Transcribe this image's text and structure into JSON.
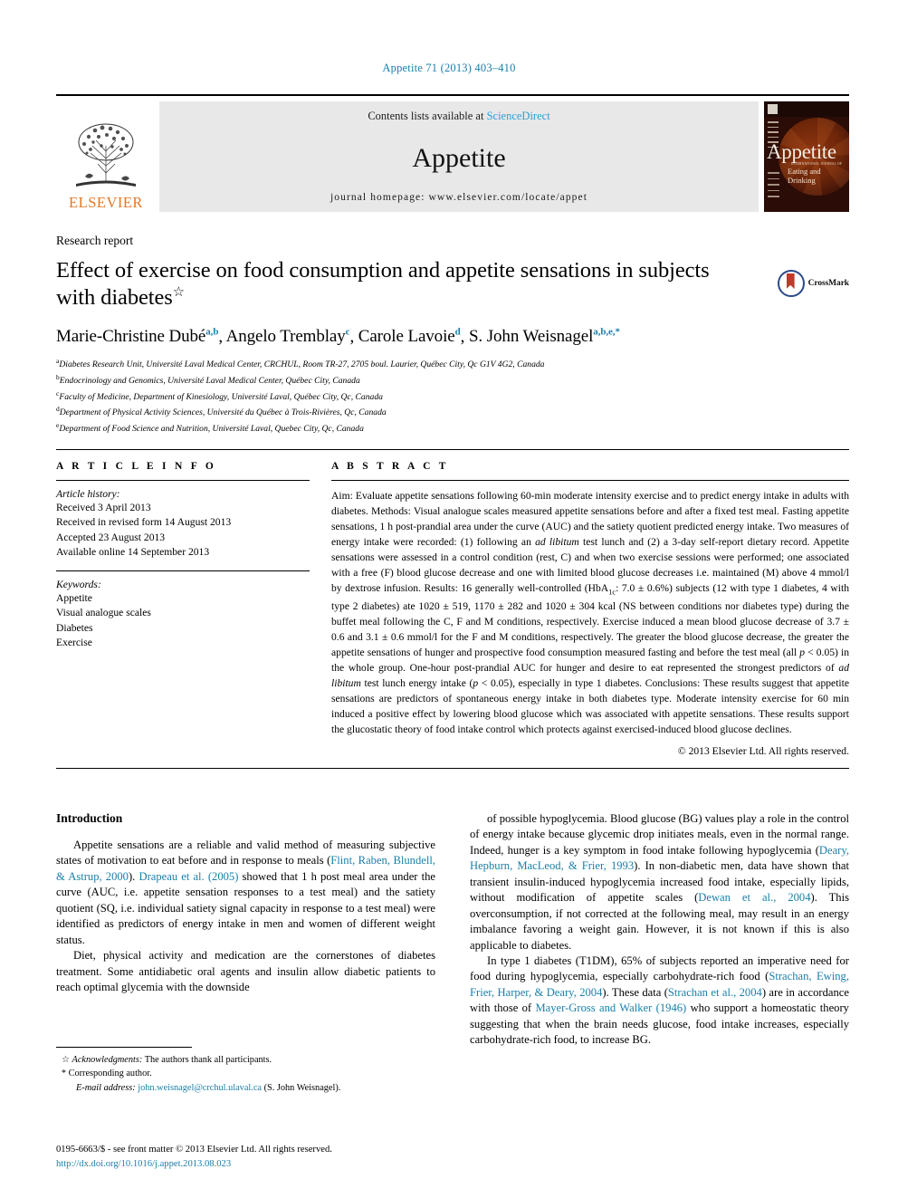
{
  "running_head": "Appetite 71 (2013) 403–410",
  "masthead": {
    "publisher_name": "ELSEVIER",
    "contents_prefix": "Contents lists available at ",
    "contents_link": "ScienceDirect",
    "journal_name": "Appetite",
    "homepage": "journal homepage: www.elsevier.com/locate/appet",
    "cover": {
      "title": "Appetite",
      "subtitle_small": "INTERNATIONAL JOURNAL OF",
      "subtitle": "Eating and Drinking"
    }
  },
  "article": {
    "kind": "Research report",
    "title": "Effect of exercise on food consumption and appetite sensations in subjects with diabetes",
    "title_footnote_mark": "☆",
    "crossmark_label": "CrossMark",
    "authors": [
      {
        "name": "Marie-Christine Dubé",
        "sup": "a,b"
      },
      {
        "name": "Angelo Tremblay",
        "sup": "c"
      },
      {
        "name": "Carole Lavoie",
        "sup": "d"
      },
      {
        "name": "S. John Weisnagel",
        "sup": "a,b,e,*"
      }
    ],
    "affiliations": [
      {
        "mark": "a",
        "text": "Diabetes Research Unit, Université Laval Medical Center, CRCHUL, Room TR-27, 2705 boul. Laurier, Québec City, Qc G1V 4G2, Canada"
      },
      {
        "mark": "b",
        "text": "Endocrinology and Genomics, Université Laval Medical Center, Québec City, Canada"
      },
      {
        "mark": "c",
        "text": "Faculty of Medicine, Department of Kinesiology, Université Laval, Québec City, Qc, Canada"
      },
      {
        "mark": "d",
        "text": "Department of Physical Activity Sciences, Université du Québec à Trois-Rivières, Qc, Canada"
      },
      {
        "mark": "e",
        "text": "Department of Food Science and Nutrition, Université Laval, Quebec City, Qc, Canada"
      }
    ]
  },
  "article_info": {
    "heading": "A R T I C L E   I N F O",
    "history_label": "Article history:",
    "history": [
      "Received 3 April 2013",
      "Received in revised form 14 August 2013",
      "Accepted 23 August 2013",
      "Available online 14 September 2013"
    ],
    "keywords_label": "Keywords:",
    "keywords": [
      "Appetite",
      "Visual analogue scales",
      "Diabetes",
      "Exercise"
    ]
  },
  "abstract": {
    "heading": "A B S T R A C T",
    "text_html": "Aim: Evaluate appetite sensations following 60-min moderate intensity exercise and to predict energy intake in adults with diabetes. Methods: Visual analogue scales measured appetite sensations before and after a fixed test meal. Fasting appetite sensations, 1 h post-prandial area under the curve (AUC) and the satiety quotient predicted energy intake. Two measures of energy intake were recorded: (1) following an <em>ad libitum</em> test lunch and (2) a 3-day self-report dietary record. Appetite sensations were assessed in a control condition (rest, C) and when two exercise sessions were performed; one associated with a free (F) blood glucose decrease and one with limited blood glucose decreases i.e. maintained (M) above 4 mmol/l by dextrose infusion. Results: 16 generally well-controlled (HbA<sub>1c</sub>: 7.0 ± 0.6%) subjects (12 with type 1 diabetes, 4 with type 2 diabetes) ate 1020 ± 519, 1170 ± 282 and 1020 ± 304 kcal (NS between conditions nor diabetes type) during the buffet meal following the C, F and M conditions, respectively. Exercise induced a mean blood glucose decrease of 3.7 ± 0.6 and 3.1 ± 0.6 mmol/l for the F and M conditions, respectively. The greater the blood glucose decrease, the greater the appetite sensations of hunger and prospective food consumption measured fasting and before the test meal (all <em>p</em> &lt; 0.05) in the whole group. One-hour post-prandial AUC for hunger and desire to eat represented the strongest predictors of <em>ad libitum</em> test lunch energy intake (<em>p</em> &lt; 0.05), especially in type 1 diabetes. Conclusions: These results suggest that appetite sensations are predictors of spontaneous energy intake in both diabetes type. Moderate intensity exercise for 60 min induced a positive effect by lowering blood glucose which was associated with appetite sensations. These results support the glucostatic theory of food intake control which protects against exercised-induced blood glucose declines.",
    "copyright": "© 2013 Elsevier Ltd. All rights reserved."
  },
  "body": {
    "section_title": "Introduction",
    "left_paragraphs_html": [
      "Appetite sensations are a reliable and valid method of measuring subjective states of motivation to eat before and in response to meals (<span class=\"ref\">Flint, Raben, Blundell, &amp; Astrup, 2000</span>). <span class=\"ref\">Drapeau et al. (2005)</span> showed that 1 h post meal area under the curve (AUC, i.e. appetite sensation responses to a test meal) and the satiety quotient (SQ, i.e. individual satiety signal capacity in response to a test meal) were identified as predictors of energy intake in men and women of different weight status.",
      "Diet, physical activity and medication are the cornerstones of diabetes treatment. Some antidiabetic oral agents and insulin allow diabetic patients to reach optimal glycemia with the downside"
    ],
    "right_paragraphs_html": [
      "of possible hypoglycemia. Blood glucose (BG) values play a role in the control of energy intake because glycemic drop initiates meals, even in the normal range. Indeed, hunger is a key symptom in food intake following hypoglycemia (<span class=\"ref\">Deary, Hepburn, MacLeod, &amp; Frier, 1993</span>). In non-diabetic men, data have shown that transient insulin-induced hypoglycemia increased food intake, especially lipids, without modification of appetite scales (<span class=\"ref\">Dewan et al., 2004</span>). This overconsumption, if not corrected at the following meal, may result in an energy imbalance favoring a weight gain. However, it is not known if this is also applicable to diabetes.",
      "In type 1 diabetes (T1DM), 65% of subjects reported an imperative need for food during hypoglycemia, especially carbohydrate-rich food (<span class=\"ref\">Strachan, Ewing, Frier, Harper, &amp; Deary, 2004</span>). These data (<span class=\"ref\">Strachan et al., 2004</span>) are in accordance with those of <span class=\"ref\">Mayer-Gross and Walker (1946)</span> who support a homeostatic theory suggesting that when the brain needs glucose, food intake increases, especially carbohydrate-rich food, to increase BG."
    ]
  },
  "footnotes": {
    "acknowledgment_mark": "☆",
    "acknowledgment_label": "Acknowledgments:",
    "acknowledgment_text": " The authors thank all participants.",
    "corresponding_mark": "*",
    "corresponding_text": "Corresponding author.",
    "email_label": "E-mail address:",
    "email": "john.weisnagel@crchul.ulaval.ca",
    "email_owner": "(S. John Weisnagel)."
  },
  "imprint": {
    "issn_line": "0195-6663/$ - see front matter © 2013 Elsevier Ltd. All rights reserved.",
    "doi": "http://dx.doi.org/10.1016/j.appet.2013.08.023"
  },
  "colors": {
    "link": "#1a7fa8",
    "elsevier_orange": "#e87722",
    "sciencedirect": "#2a9fd6"
  }
}
